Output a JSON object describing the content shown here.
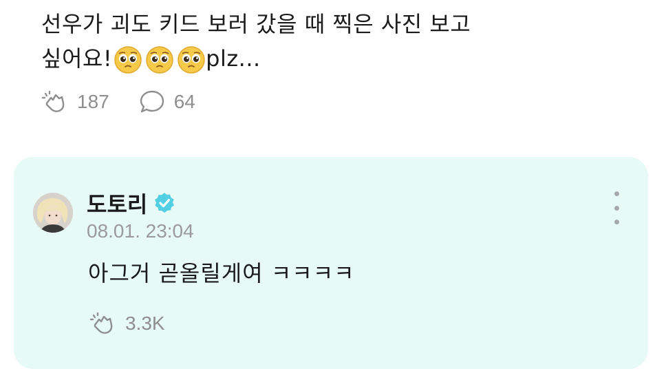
{
  "post": {
    "text_line1": "선우가 괴도 키드 보러 갔을 때 찍은 사진 보고",
    "text_line2_prefix": "싶어요!",
    "text_line2_suffix": "plz...",
    "emojis": [
      "pleading-face-emoji",
      "pleading-face-emoji",
      "pleading-face-emoji"
    ],
    "like_count": "187",
    "comment_count": "64"
  },
  "comment": {
    "author": "도토리",
    "verified_icon": "verified-badge-icon",
    "timestamp": "08.01. 23:04",
    "text": "아그거 곧올릴게여 ㅋㅋㅋㅋ",
    "like_count": "3.3K"
  },
  "colors": {
    "card_background": "#e7faf6",
    "verified_badge": "#53cfe4",
    "muted_text": "#8e8e8e"
  }
}
